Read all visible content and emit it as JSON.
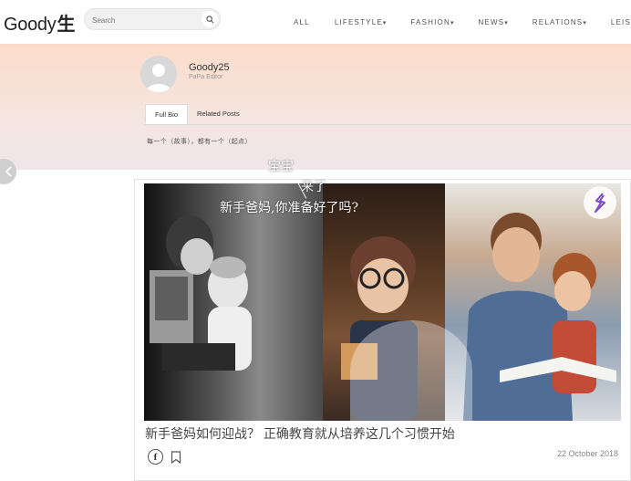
{
  "header": {
    "logo": {
      "text": "Goody",
      "mark": "生"
    },
    "search": {
      "placeholder": "Search"
    },
    "nav": [
      {
        "label": "ALL",
        "dropdown": false
      },
      {
        "label": "LIFESTYLE",
        "dropdown": true
      },
      {
        "label": "FASHION",
        "dropdown": true
      },
      {
        "label": "NEWS",
        "dropdown": true
      },
      {
        "label": "RELATIONS",
        "dropdown": true
      },
      {
        "label": "LEISURE",
        "dropdown": false
      }
    ],
    "caret": "▾"
  },
  "profile": {
    "name": "Goody25",
    "role": "PaPa Editor",
    "tabs": [
      "Full Bio",
      "Related Posts"
    ],
    "bio": "每一个（故事），都有一个（起点）"
  },
  "article": {
    "overlay_line1": "宝宝",
    "overlay_line2": "来了",
    "overlay_line3": "新手爸妈,你准备好了吗?",
    "title": "新手爸妈如何迎战？ 正确教育就从培养这几个习惯开始",
    "date": "22 October 2018",
    "share_glyph": "f"
  },
  "colors": {
    "band_top": "#fbdcc9",
    "band_bottom": "#efe6ea",
    "text": "#333333",
    "muted": "#888888"
  }
}
